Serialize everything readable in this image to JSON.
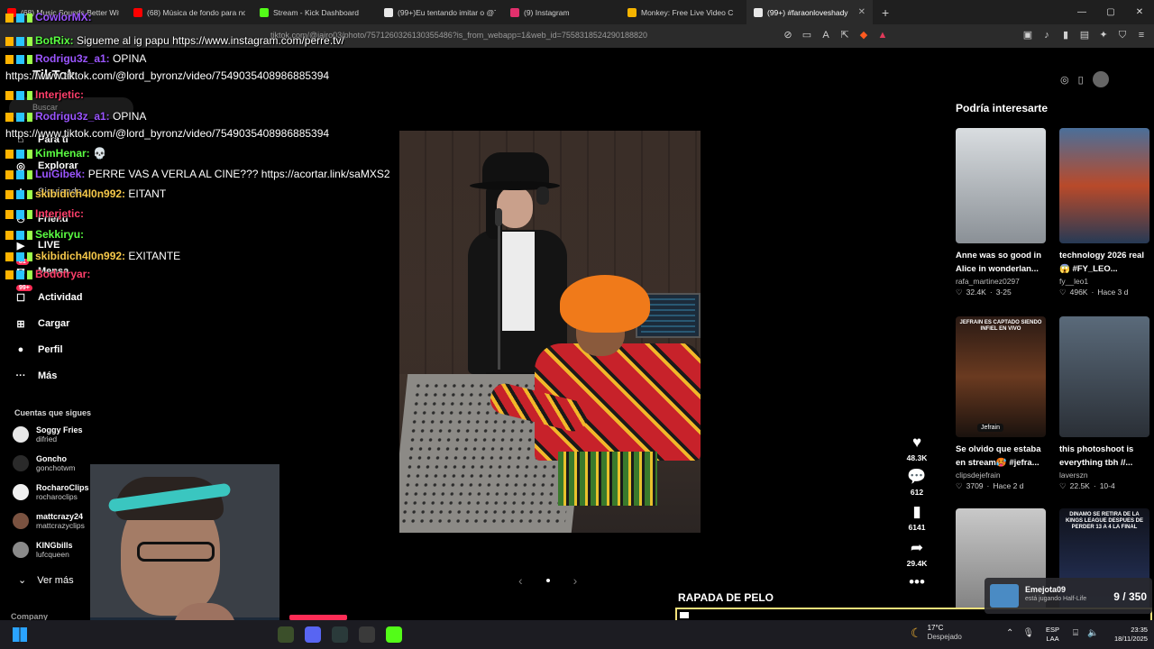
{
  "browser": {
    "tabs": [
      {
        "label": "(68) Music Sounds Better With",
        "fav": "#ff0000"
      },
      {
        "label": "(68) Música de fondo para not",
        "fav": "#ff0000"
      },
      {
        "label": "Stream - Kick Dashboard",
        "fav": "#53fc18"
      },
      {
        "label": "(99+)Eu tentando imitar o @Te",
        "fav": "#e8e8e8"
      },
      {
        "label": "(9) Instagram",
        "fav": "#e1306c"
      },
      {
        "label": "Monkey: Free Live Video C",
        "fav": "#f5b400"
      },
      {
        "label": "(99+) #faraonloveshady",
        "fav": "#e8e8e8",
        "active": true
      }
    ],
    "new_tab": "+",
    "url": "tiktok.com/@jairo03/photo/7571260326130355486?is_from_webapp=1&web_id=7558318524290188820"
  },
  "tiktok": {
    "logo": "TikTok",
    "search_placeholder": "Buscar",
    "nav": {
      "para_ti": "Para ti",
      "explorar": "Explorar",
      "siguiendo": "Siguiendo",
      "amigos": "Friend",
      "live": "LIVE",
      "mensajes": "Mensa",
      "actividad": "Actividad",
      "actividad_badge": "99+",
      "mensajes_badge": "81",
      "cargar": "Cargar",
      "perfil": "Perfil",
      "mas": "Más"
    },
    "following_title": "Cuentas que sigues",
    "following": [
      {
        "name": "Soggy Fries",
        "handle": "difried",
        "color": "#e8e8e8"
      },
      {
        "name": "Goncho",
        "handle": "gonchotwm",
        "color": "#2a2a2a"
      },
      {
        "name": "RocharoClips",
        "handle": "rocharoclips",
        "color": "#f0f0f0"
      },
      {
        "name": "mattcrazy24",
        "handle": "mattcrazyclips",
        "color": "#7a5240"
      },
      {
        "name": "KINGbills",
        "handle": "lufcqueen",
        "color": "#8a8a8a"
      }
    ],
    "ver_mas": "Ver más",
    "company": "Company",
    "actions": {
      "likes": "48.3K",
      "comments": "612",
      "saves": "6141",
      "shares": "29.4K"
    },
    "suggestions_title": "Podría interesarte",
    "suggestions": [
      {
        "title": "Anne was so good in Alice in wonderlan...",
        "user": "rafa_martinez0297",
        "likes": "32.4K",
        "date": "3-25"
      },
      {
        "title": "technology 2026 real 😱 #FY_LEO...",
        "user": "fy__leo1",
        "likes": "496K",
        "date": "Hace 3 d"
      },
      {
        "title": "Se olvido que estaba en stream🥵 #jefra...",
        "user": "clipsdejefrain",
        "likes": "3709",
        "date": "Hace 2 d",
        "thumb_text": "JEFRAIN ES CAPTADO SIENDO INFIEL EN VIVO",
        "tag": "Jefrain"
      },
      {
        "title": "this photoshoot is everything tbh //...",
        "user": "laverszn",
        "likes": "22.5K",
        "date": "10-4"
      },
      {
        "title": "",
        "user": "",
        "likes": "",
        "date": ""
      },
      {
        "title": "",
        "user": "",
        "likes": "",
        "date": "",
        "thumb_text": "DINAMO SE RETIRA DE LA KINGS LEAGUE DESPUES DE PERDER 13 A 4 LA FINAL"
      }
    ]
  },
  "chat": [
    {
      "user": "CowlorMX:",
      "msg": "",
      "color": "purple"
    },
    {
      "user": "BotRix:",
      "msg": "Sigueme al ig papu https://www.instagram.com/perre.tv/",
      "color": "green"
    },
    {
      "user": "Rodrigu3z_a1:",
      "msg": "OPINA",
      "color": "purple"
    },
    {
      "user": "",
      "msg": "https://www.tiktok.com/@lord_byronz/video/7549035408986885394",
      "color": ""
    },
    {
      "user": "Interjetic:",
      "msg": "",
      "color": "pink"
    },
    {
      "user": "Rodrigu3z_a1:",
      "msg": "OPINA",
      "color": "purple"
    },
    {
      "user": "",
      "msg": "https://www.tiktok.com/@lord_byronz/video/7549035408986885394",
      "color": ""
    },
    {
      "user": "KimHenar:",
      "msg": "💀",
      "color": "green"
    },
    {
      "user": "LuiGibek:",
      "msg": "PERRE VAS A VERLA AL CINE??? https://acortar.link/saMXS2",
      "color": "purple"
    },
    {
      "user": "skibidich4l0n992:",
      "msg": "EITANT",
      "color": "gold"
    },
    {
      "user": "Interjetic:",
      "msg": "",
      "color": "pink"
    },
    {
      "user": "Sekkiryu:",
      "msg": "",
      "color": "green"
    },
    {
      "user": "skibidich4l0n992:",
      "msg": "EXITANTE",
      "color": "gold"
    },
    {
      "user": "Bodotryar:",
      "msg": "",
      "color": "pink"
    }
  ],
  "overlay": {
    "goal_label": "RAPADA DE PELO",
    "goal_progress": 0.02,
    "game_user": "Emejota09",
    "game_status": "está jugando",
    "game_name": "Half-Life",
    "game_count": "9 / 350"
  },
  "taskbar": {
    "temp": "17°C",
    "weather": "Despejado",
    "lang1": "ESP",
    "lang2": "LAA",
    "time": "23:35",
    "date": "18/11/2025"
  }
}
